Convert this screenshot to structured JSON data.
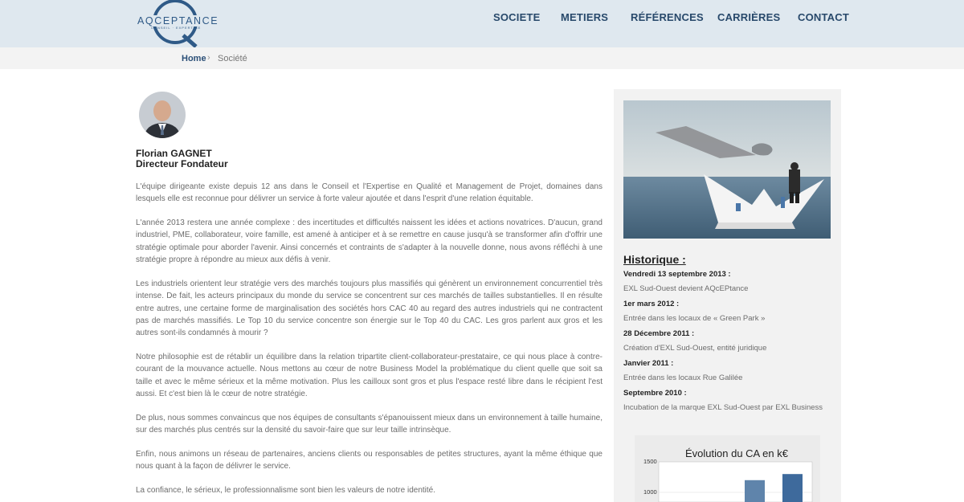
{
  "header": {
    "logo_text": "AQCEPTANCE",
    "logo_sub": "CONSEIL · EXPERTISE",
    "nav": [
      "SOCIETE",
      "METIERS",
      "RÉFÉRENCES",
      "CARRIÈRES",
      "CONTACT"
    ]
  },
  "breadcrumb": {
    "home": "Home",
    "separator": "›",
    "current": "Société"
  },
  "person": {
    "name": "Florian GAGNET",
    "title": "Directeur Fondateur"
  },
  "paragraphs": [
    "L'équipe dirigeante existe depuis 12 ans dans le Conseil et l'Expertise en Qualité et Management de Projet, domaines dans lesquels elle est reconnue pour délivrer un service à forte valeur ajoutée et dans l'esprit d'une relation équitable.",
    "L'année 2013 restera une année complexe : des incertitudes et difficultés naissent les idées et actions novatrices. D'aucun, grand industriel, PME, collaborateur, voire famille, est amené à anticiper et à se remettre en cause jusqu'à se transformer afin d'offrir une stratégie optimale pour aborder l'avenir. Ainsi concernés et contraints de s'adapter à la nouvelle donne, nous avons réfléchi à une stratégie propre à répondre au mieux aux défis à venir.",
    "Les industriels orientent leur stratégie vers des marchés toujours plus massifiés qui génèrent un environnement concurrentiel très intense. De fait, les acteurs principaux du monde du service se concentrent sur ces marchés de tailles substantielles. Il en résulte entre autres, une certaine forme de marginalisation des sociétés hors CAC 40 au regard des autres industriels qui ne contractent pas de marchés massifiés. Le Top 10 du service concentre son énergie sur le Top 40 du CAC. Les gros parlent aux gros et les autres sont-ils condamnés à mourir ?",
    "Notre philosophie est de rétablir un équilibre dans la relation tripartite client-collaborateur-prestataire, ce qui nous place à contre-courant de la mouvance actuelle. Nous mettons au cœur de notre Business Model la problématique du client quelle que soit sa taille et avec le même sérieux et la même motivation. Plus les cailloux sont gros et plus l'espace resté libre dans le récipient l'est aussi. Et c'est bien là le cœur de notre stratégie.",
    "De plus, nous sommes convaincus que nos équipes de consultants s'épanouissent mieux dans un environnement à taille humaine, sur des marchés plus centrés sur la densité du savoir-faire que sur leur taille intrinsèque.",
    "Enfin, nous animons un réseau de partenaires, anciens clients ou responsables de petites structures, ayant la même éthique que nous quant à la façon de délivrer le service.",
    "La confiance, le sérieux, le professionnalisme sont bien les valeurs de notre identité."
  ],
  "sidebar": {
    "historique_title": "Historique :",
    "events": [
      {
        "date": "Vendredi 13 septembre 2013 :",
        "text": "EXL Sud-Ouest devient AQcEPtance"
      },
      {
        "date": "1er mars 2012 :",
        "text": "Entrée dans les locaux de « Green Park »"
      },
      {
        "date": "28 Décembre 2011 :",
        "text": "Création d'EXL Sud-Ouest, entité juridique"
      },
      {
        "date": "Janvier 2011 :",
        "text": "Entrée dans les locaux Rue Galilée"
      },
      {
        "date": "Septembre 2010 :",
        "text": "Incubation de la marque EXL Sud-Ouest par EXL Business"
      }
    ]
  },
  "chart_data": {
    "type": "bar",
    "title": "Évolution du CA en k€",
    "y_ticks": [
      "1500",
      "1000"
    ],
    "values": [
      1200,
      1300
    ],
    "ylim": [
      0,
      1500
    ],
    "colors": [
      "#5f84ab",
      "#3e6a9c"
    ]
  }
}
